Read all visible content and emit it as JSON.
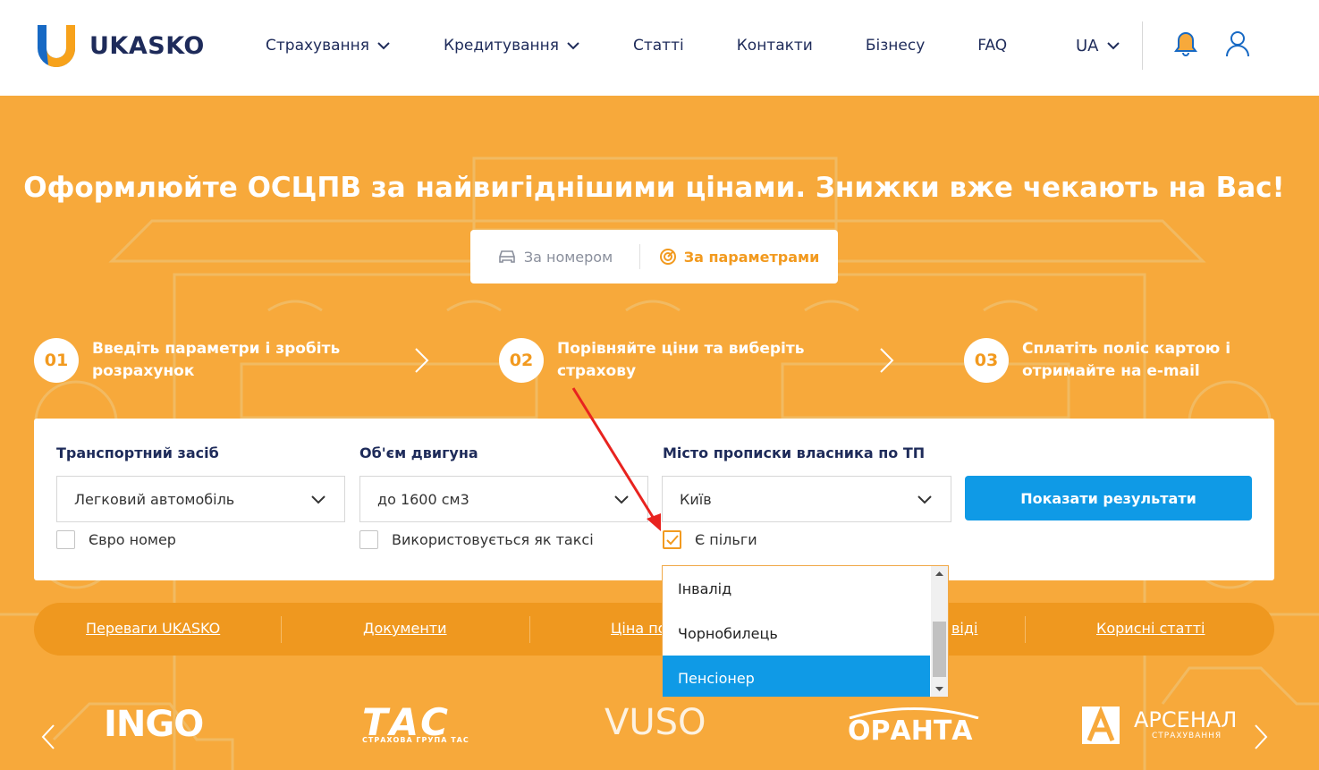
{
  "header": {
    "logo_text": "UKASKO",
    "nav": [
      {
        "label": "Страхування",
        "has_dropdown": true
      },
      {
        "label": "Кредитування",
        "has_dropdown": true
      },
      {
        "label": "Статті",
        "has_dropdown": false
      },
      {
        "label": "Контакти",
        "has_dropdown": false
      },
      {
        "label": "Бізнесу",
        "has_dropdown": false
      },
      {
        "label": "FAQ",
        "has_dropdown": false
      }
    ],
    "language": "UA",
    "icons": [
      "bell-icon",
      "user-icon"
    ]
  },
  "hero": {
    "title": "Оформлюйте ОСЦПВ за найвигіднішими цінами. Знижки вже чекають на Вас!",
    "tabs": [
      {
        "label": "За номером",
        "active": false,
        "icon": "car-icon"
      },
      {
        "label": "За параметрами",
        "active": true,
        "icon": "gauge-icon"
      }
    ],
    "steps": [
      {
        "num": "01",
        "text": "Введіть параметри і зробіть розрахунок"
      },
      {
        "num": "02",
        "text": "Порівняйте ціни та виберіть страхову"
      },
      {
        "num": "03",
        "text": "Сплатіть поліс картою і отримайте на e-mail"
      }
    ]
  },
  "form": {
    "vehicle": {
      "label": "Транспортний засіб",
      "value": "Легковий автомобіль"
    },
    "engine": {
      "label": "Об'єм двигуна",
      "value": "до 1600 см3"
    },
    "city": {
      "label": "Місто прописки власника по ТП",
      "value": "Київ"
    },
    "submit_label": "Показати результати",
    "checkboxes": [
      {
        "label": "Євро номер",
        "checked": false
      },
      {
        "label": "Використовується як таксі",
        "checked": false
      },
      {
        "label": "Є пільги",
        "checked": true
      }
    ],
    "benefits_options": [
      {
        "label": "Інвалід",
        "selected": false
      },
      {
        "label": "Чорнобилець",
        "selected": false
      },
      {
        "label": "Пенсіонер",
        "selected": true
      }
    ]
  },
  "links_bar": {
    "items": [
      "Переваги UKASKO",
      "Документи",
      "Ціна по",
      "віді",
      "Корисні статті"
    ]
  },
  "partners": [
    "INGO",
    "ТАС",
    "СТРАХОВА ГРУПА ТАС",
    "VUSO",
    "ОРАНТА",
    "АРСЕНАЛ",
    "СТРАХУВАННЯ"
  ],
  "colors": {
    "brand_orange": "#f7a93b",
    "accent_blue": "#0f9ae6",
    "navy": "#1e2b5a"
  }
}
